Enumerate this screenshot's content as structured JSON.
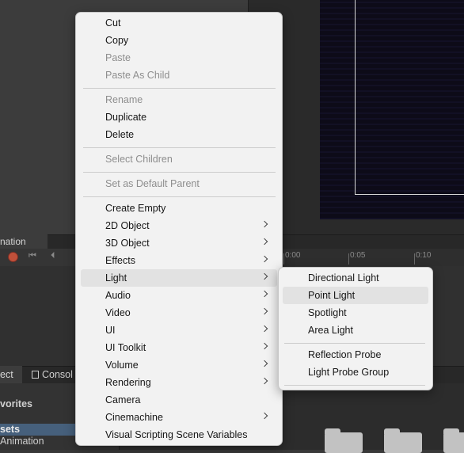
{
  "colors": {
    "menu_bg": "#f2f2f2",
    "menu_highlight": "#e2e2e2",
    "disabled_text": "#8e8e8e",
    "editor_bg": "#383838",
    "selection_blue": "#46607c",
    "record_red": "#c0503a"
  },
  "background": {
    "animation_tab": "nation",
    "timeline_labels": [
      "0:00",
      "0:05",
      "0:10"
    ],
    "project_tab": "ect",
    "console_tab": "Consol",
    "favorites_label": "vorites",
    "assets_label": "sets",
    "animation_folder": "Animation"
  },
  "context_menu": {
    "items": [
      {
        "label": "Cut"
      },
      {
        "label": "Copy"
      },
      {
        "label": "Paste",
        "disabled": true
      },
      {
        "label": "Paste As Child",
        "disabled": true
      },
      {
        "label": "Rename",
        "disabled": true
      },
      {
        "label": "Duplicate"
      },
      {
        "label": "Delete"
      },
      {
        "label": "Select Children",
        "disabled": true
      },
      {
        "label": "Set as Default Parent",
        "disabled": true
      },
      {
        "label": "Create Empty"
      },
      {
        "label": "2D Object",
        "submenu": true
      },
      {
        "label": "3D Object",
        "submenu": true
      },
      {
        "label": "Effects",
        "submenu": true
      },
      {
        "label": "Light",
        "submenu": true,
        "highlighted": true
      },
      {
        "label": "Audio",
        "submenu": true
      },
      {
        "label": "Video",
        "submenu": true
      },
      {
        "label": "UI",
        "submenu": true
      },
      {
        "label": "UI Toolkit",
        "submenu": true
      },
      {
        "label": "Volume",
        "submenu": true
      },
      {
        "label": "Rendering",
        "submenu": true
      },
      {
        "label": "Camera"
      },
      {
        "label": "Cinemachine",
        "submenu": true
      },
      {
        "label": "Visual Scripting Scene Variables"
      }
    ]
  },
  "light_submenu": {
    "items": [
      {
        "label": "Directional Light"
      },
      {
        "label": "Point Light",
        "highlighted": true
      },
      {
        "label": "Spotlight"
      },
      {
        "label": "Area Light"
      },
      {
        "label": "Reflection Probe"
      },
      {
        "label": "Light Probe Group"
      }
    ]
  }
}
